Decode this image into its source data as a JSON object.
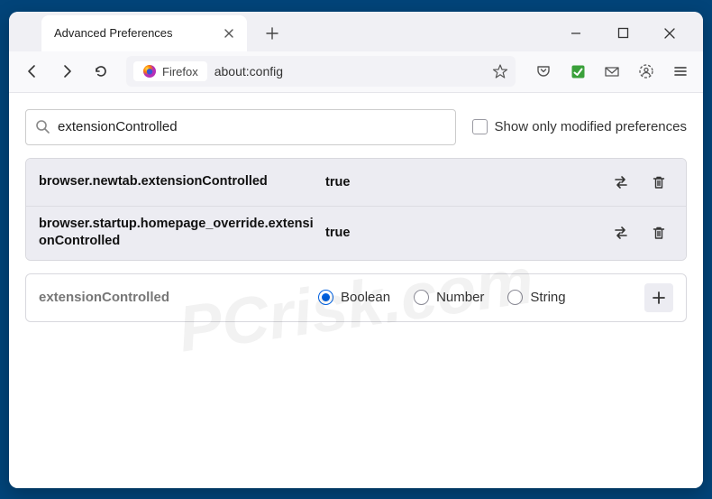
{
  "window": {
    "tab_title": "Advanced Preferences"
  },
  "toolbar": {
    "identity_label": "Firefox",
    "url": "about:config"
  },
  "content": {
    "search_value": "extensionControlled",
    "checkbox_label": "Show only modified preferences",
    "checkbox_checked": false,
    "prefs": [
      {
        "name": "browser.newtab.extensionControlled",
        "value": "true"
      },
      {
        "name": "browser.startup.homepage_override.extensionControlled",
        "value": "true"
      }
    ],
    "add": {
      "name": "extensionControlled",
      "types": [
        "Boolean",
        "Number",
        "String"
      ],
      "selected": "Boolean"
    }
  },
  "watermark": "PCrisk.com"
}
